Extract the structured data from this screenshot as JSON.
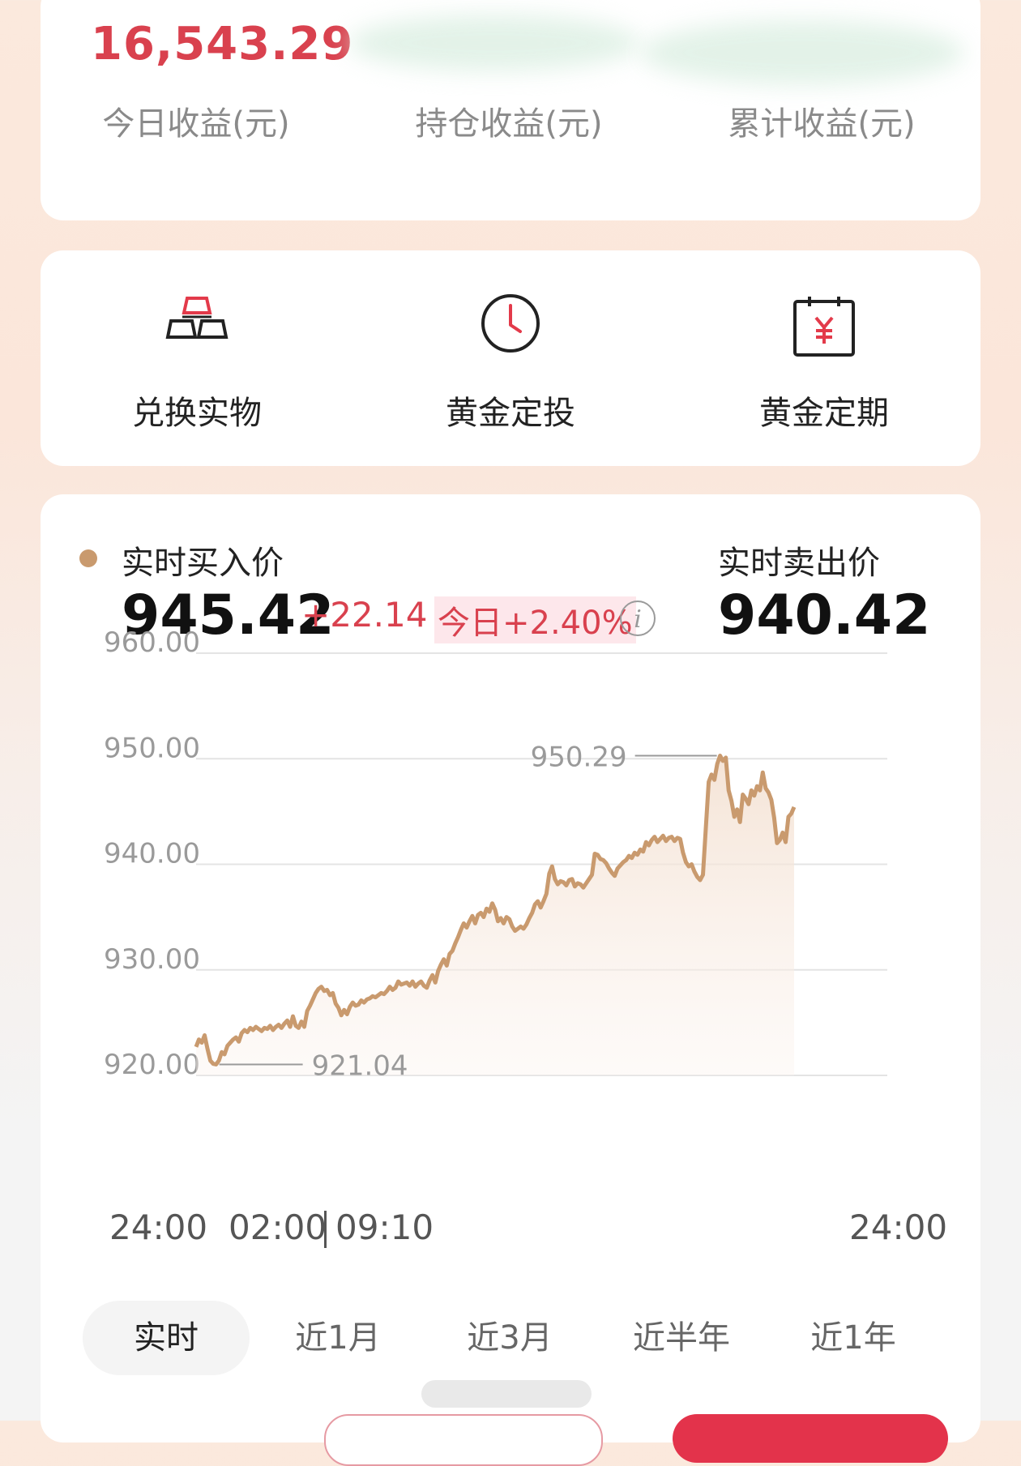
{
  "earnings": {
    "today_value": "16,543.29",
    "labels": [
      "今日收益(元)",
      "持仓收益(元)",
      "累计收益(元)"
    ]
  },
  "actions": [
    {
      "label": "兑换实物",
      "icon": "gold-bars-icon"
    },
    {
      "label": "黄金定投",
      "icon": "clock-icon"
    },
    {
      "label": "黄金定期",
      "icon": "calendar-yen-icon"
    }
  ],
  "price": {
    "buy_title": "实时买入价",
    "buy_price": "945.42",
    "change": "+22.14",
    "today_pct": "今日+2.40%",
    "sell_title": "实时卖出价",
    "sell_price": "940.42",
    "info_icon": "i"
  },
  "chart_data": {
    "type": "line",
    "ylim": [
      920,
      960
    ],
    "yticks": [
      "960.00",
      "950.00",
      "940.00",
      "930.00",
      "920.00"
    ],
    "ytick_values": [
      960,
      950,
      940,
      930,
      920
    ],
    "xlabels": [
      "24:00",
      "02:00",
      "09:10",
      "24:00"
    ],
    "max_label": "950.29",
    "max_value": 950.29,
    "min_label": "921.04",
    "min_value": 921.04,
    "line_color": "#c99a6e",
    "grid": true,
    "series": [
      {
        "values": [
          922.7,
          923.4,
          923.1,
          923.8,
          922.5,
          921.4,
          921.1,
          921.04,
          921.4,
          922.2,
          922.0,
          922.8,
          923.1,
          923.4,
          923.6,
          923.2,
          924.0,
          924.3,
          924.1,
          924.5,
          924.3,
          924.6,
          924.4,
          924.2,
          924.5,
          924.4,
          924.7,
          924.3,
          924.6,
          924.8,
          924.5,
          924.9,
          925.2,
          924.6,
          925.6,
          924.7,
          924.5,
          925.1,
          924.6,
          926.1,
          926.6,
          927.2,
          927.8,
          928.2,
          928.4,
          928.0,
          928.1,
          927.6,
          927.8,
          926.8,
          926.4,
          925.7,
          926.2,
          925.8,
          926.5,
          926.9,
          926.6,
          926.7,
          927.1,
          926.9,
          927.2,
          927.3,
          927.5,
          927.4,
          927.6,
          927.8,
          927.7,
          928.0,
          928.4,
          928.1,
          928.3,
          928.9,
          928.6,
          928.7,
          928.8,
          928.5,
          928.9,
          928.4,
          928.7,
          928.9,
          928.5,
          928.3,
          929.0,
          929.5,
          928.8,
          929.9,
          930.5,
          931.0,
          930.4,
          931.5,
          931.8,
          932.5,
          933.1,
          933.8,
          934.4,
          934.0,
          934.6,
          935.1,
          934.4,
          935.2,
          935.4,
          935.0,
          935.8,
          935.5,
          936.3,
          935.7,
          934.6,
          934.9,
          934.4,
          935.0,
          934.8,
          934.1,
          933.7,
          933.9,
          934.1,
          933.9,
          934.3,
          934.9,
          935.4,
          936.2,
          936.5,
          935.9,
          936.5,
          937.2,
          939.1,
          939.8,
          938.6,
          938.1,
          938.4,
          938.3,
          938.0,
          938.5,
          938.6,
          937.9,
          938.2,
          938.1,
          937.8,
          938.2,
          938.6,
          939.0,
          941.0,
          940.9,
          940.5,
          940.4,
          940.1,
          939.6,
          939.2,
          938.9,
          939.6,
          939.9,
          940.2,
          940.4,
          940.8,
          940.6,
          941.1,
          940.9,
          941.4,
          941.2,
          942.1,
          941.8,
          942.3,
          942.6,
          942.1,
          942.4,
          942.7,
          942.2,
          942.5,
          942.6,
          942.2,
          942.5,
          942.4,
          941.1,
          940.2,
          939.8,
          940.0,
          939.3,
          938.8,
          938.5,
          939.0,
          943.5,
          947.8,
          948.5,
          948.0,
          949.5,
          950.29,
          949.8,
          950.1,
          947.0,
          946.0,
          944.5,
          945.2,
          944.0,
          946.6,
          946.2,
          945.7,
          947.0,
          946.5,
          947.4,
          947.0,
          948.7,
          947.2,
          946.8,
          946.1,
          944.4,
          942.0,
          942.3,
          943.0,
          942.1,
          944.5,
          944.8,
          945.42
        ]
      }
    ]
  },
  "tabs": [
    "实时",
    "近1月",
    "近3月",
    "近半年",
    "近1年"
  ],
  "active_tab": 0
}
